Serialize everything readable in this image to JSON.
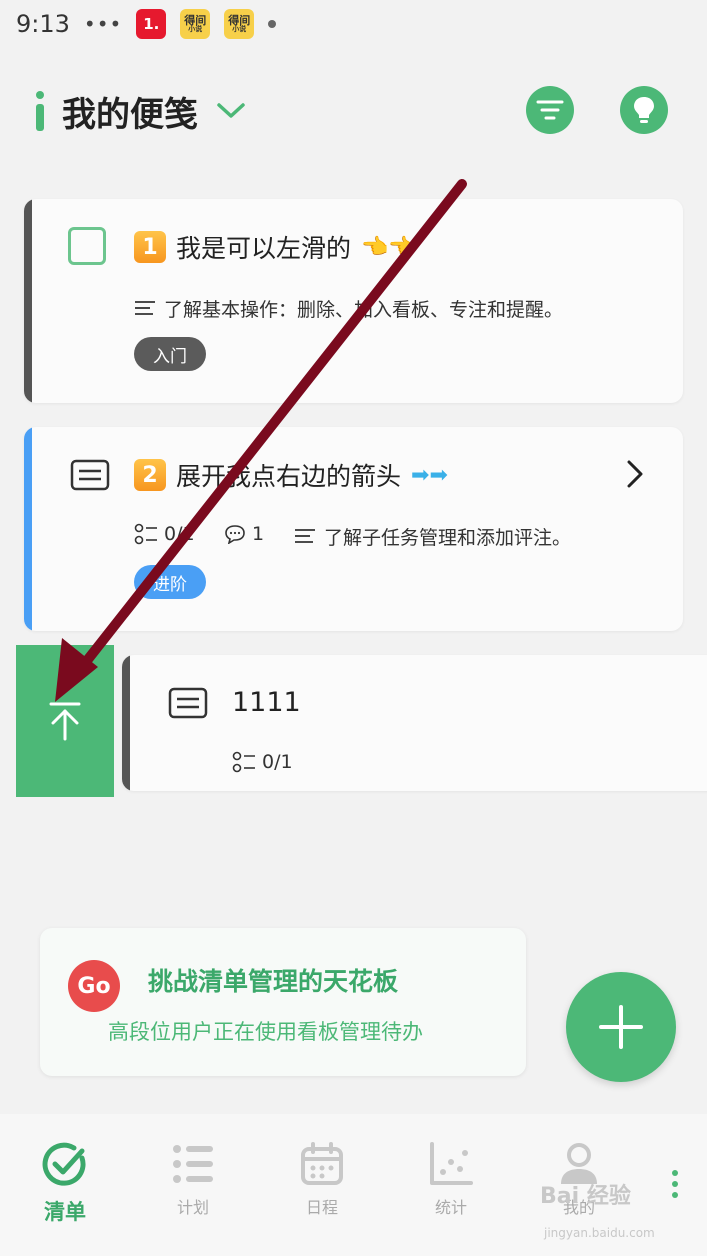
{
  "status_bar": {
    "time": "9:13",
    "dots": "•••",
    "badge_1": "1.",
    "badge_2_top": "得间",
    "badge_2_bottom": "小说",
    "badge_3_top": "得间",
    "badge_3_bottom": "小说"
  },
  "header": {
    "title": "我的便笺"
  },
  "tasks": [
    {
      "number": "1",
      "title": "我是可以左滑的",
      "title_emoji": "👈👈",
      "description": "了解基本操作：删除、加入看板、专注和提醒。",
      "tag": "入门",
      "bar_color": "#555555",
      "tag_color": "#5b5b5b"
    },
    {
      "number": "2",
      "title": "展开我点右边的箭头",
      "title_emoji": "➡➡",
      "subtasks": "0/1",
      "comments": "1",
      "description": "了解子任务管理和添加评注。",
      "tag": "进阶",
      "bar_color": "#4a9ff5",
      "tag_color": "#4a9ff5"
    },
    {
      "title": "1111",
      "subtasks": "0/1",
      "bar_color": "#555555"
    }
  ],
  "promo": {
    "icon_text": "Go",
    "title": "挑战清单管理的天花板",
    "subtitle": "高段位用户正在使用看板管理待办"
  },
  "bottom_nav": {
    "items": [
      {
        "label": "清单",
        "icon": "checkmark-circle-icon",
        "active": true
      },
      {
        "label": "计划",
        "icon": "list-icon",
        "active": false
      },
      {
        "label": "日程",
        "icon": "calendar-icon",
        "active": false
      },
      {
        "label": "统计",
        "icon": "scatter-chart-icon",
        "active": false
      },
      {
        "label": "我的",
        "icon": "person-icon",
        "active": false
      }
    ]
  },
  "watermark": {
    "text": "Bai 经验",
    "sub": "jingyan.baidu.com"
  },
  "colors": {
    "accent": "#4cb877",
    "annotation_arrow": "#7a0a1e"
  }
}
